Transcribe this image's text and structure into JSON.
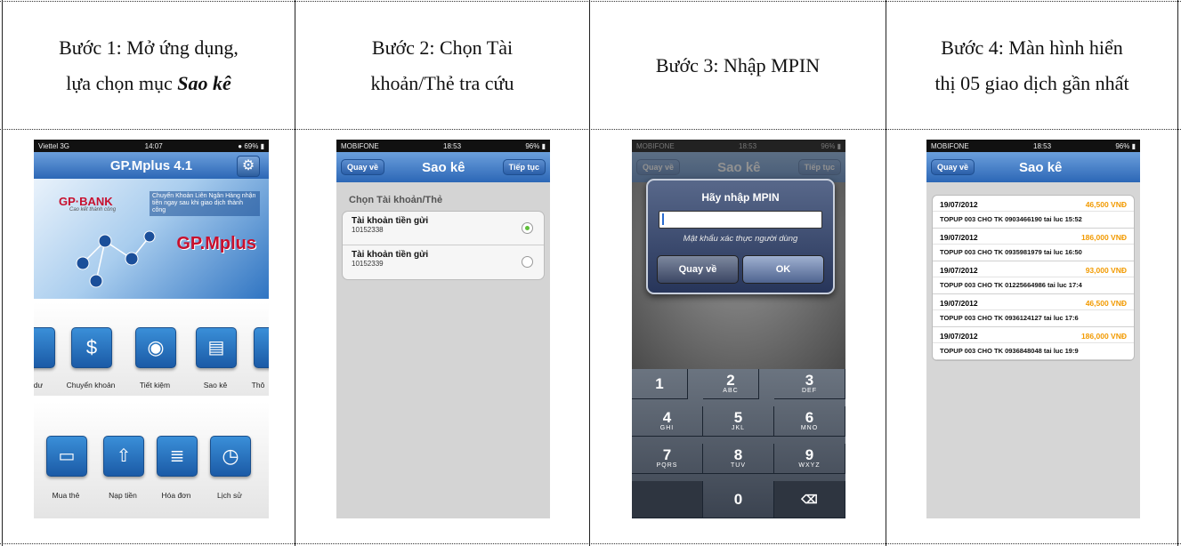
{
  "steps": [
    {
      "line1": "Bước 1: Mở ứng dụng,",
      "line2_plain": "lựa chọn mục ",
      "line2_em": "Sao kê"
    },
    {
      "line1": "Bước 2: Chọn Tài",
      "line2": "khoản/Thẻ tra cứu"
    },
    {
      "line1": "Bước 3: Nhập MPIN"
    },
    {
      "line1": "Bước 4: Màn hình hiển",
      "line2": "thị 05 giao dịch gần nhất"
    }
  ],
  "phone1": {
    "carrier": "Viettel  3G",
    "time": "14:07",
    "battery": "69%",
    "title": "GP.Mplus 4.1",
    "banner_brand": "GP·BANK",
    "banner_tagline": "Cao kết thành công",
    "banner_text": "Chuyển Khoản Liên Ngân Hàng nhận tiền ngay sau khi giao dịch thành công",
    "banner_logo": "GP.Mplus",
    "row1": [
      "dư",
      "Chuyển khoản",
      "Tiết kiệm",
      "Sao kê",
      "Thô"
    ],
    "row2": [
      "Mua thẻ",
      "Nạp tiền",
      "Hóa đơn",
      "Lịch sử"
    ]
  },
  "phone2": {
    "carrier": "MOBIFONE",
    "time": "18:53",
    "battery": "96%",
    "back": "Quay về",
    "title": "Sao kê",
    "next": "Tiếp tục",
    "section": "Chọn Tài khoản/Thẻ",
    "accounts": [
      {
        "name": "Tài khoản tiền gửi",
        "number": "10152338"
      },
      {
        "name": "Tài khoản tiền gửi",
        "number": "10152339"
      }
    ]
  },
  "phone3": {
    "carrier": "MOBIFONE",
    "time": "18:53",
    "battery": "96%",
    "back": "Quay về",
    "title": "Sao kê",
    "next": "Tiếp tục",
    "dialog_title": "Hãy nhập MPIN",
    "dialog_hint": "Mật khẩu xác thực người dùng",
    "btn_back": "Quay về",
    "btn_ok": "OK",
    "keys": [
      {
        "n": "1",
        "l": ""
      },
      {
        "n": "2",
        "l": "ABC"
      },
      {
        "n": "3",
        "l": "DEF"
      },
      {
        "n": "4",
        "l": "GHI"
      },
      {
        "n": "5",
        "l": "JKL"
      },
      {
        "n": "6",
        "l": "MNO"
      },
      {
        "n": "7",
        "l": "PQRS"
      },
      {
        "n": "8",
        "l": "TUV"
      },
      {
        "n": "9",
        "l": "WXYZ"
      },
      {
        "n": "",
        "l": ""
      },
      {
        "n": "0",
        "l": ""
      },
      {
        "n": "⌫",
        "l": ""
      }
    ]
  },
  "phone4": {
    "carrier": "MOBIFONE",
    "time": "18:53",
    "battery": "96%",
    "back": "Quay về",
    "title": "Sao kê",
    "transactions": [
      {
        "date": "19/07/2012",
        "amount": "46,500 VNĐ",
        "desc": "TOPUP 003 CHO TK 0903466190 tai luc 15:52"
      },
      {
        "date": "19/07/2012",
        "amount": "186,000 VNĐ",
        "desc": "TOPUP 003 CHO TK 0935981979 tai luc 16:50"
      },
      {
        "date": "19/07/2012",
        "amount": "93,000 VNĐ",
        "desc": "TOPUP 003 CHO TK 01225664986 tai luc 17:4"
      },
      {
        "date": "19/07/2012",
        "amount": "46,500 VNĐ",
        "desc": "TOPUP 003 CHO TK 0936124127 tai luc 17:6"
      },
      {
        "date": "19/07/2012",
        "amount": "186,000 VNĐ",
        "desc": "TOPUP 003 CHO TK 0936848048 tai luc 19:9"
      }
    ]
  },
  "colors": {
    "nav_blue": "#2c67b6",
    "amount_orange": "#f29a00"
  }
}
